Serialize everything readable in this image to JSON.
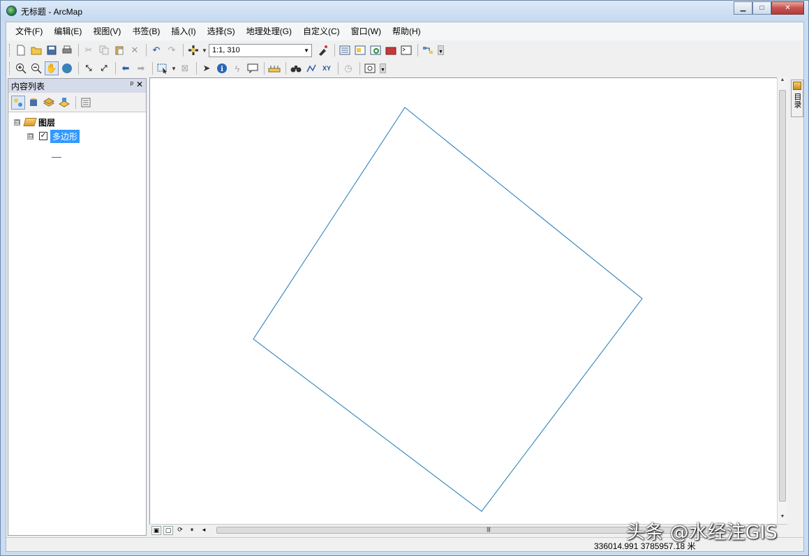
{
  "window": {
    "title": "无标题 - ArcMap",
    "buttons": {
      "minimize": "▁",
      "maximize": "□",
      "close": "✕"
    }
  },
  "menu": [
    "文件(F)",
    "编辑(E)",
    "视图(V)",
    "书签(B)",
    "插入(I)",
    "选择(S)",
    "地理处理(G)",
    "自定义(C)",
    "窗口(W)",
    "帮助(H)"
  ],
  "toolbar": {
    "scale_value": "1:1, 310"
  },
  "toc": {
    "title": "内容列表",
    "pin": "ᵖ",
    "close": "✕",
    "root_label": "图层",
    "layer_label": "多边形",
    "root_expander": "⊟",
    "layer_expander": "⊟",
    "check": "✓"
  },
  "catalog_tab": "目录",
  "status": {
    "coordinates": "336014.991  3785957.18 米"
  },
  "watermark": "头条 @水经注GIS",
  "colors": {
    "polygon_stroke": "#1f77b4",
    "selection": "#3399ff",
    "toc_header": "#d6dbe9"
  }
}
